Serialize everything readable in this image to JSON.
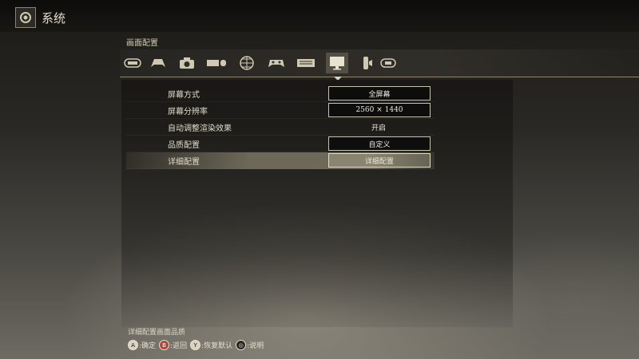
{
  "header": {
    "title": "系统",
    "icon": "gear-icon"
  },
  "section": {
    "title": "画面配置"
  },
  "tabs": [
    {
      "icon": "game-settings-icon"
    },
    {
      "icon": "controller-icon"
    },
    {
      "icon": "camera-icon"
    },
    {
      "icon": "keyboard-mouse-icon"
    },
    {
      "icon": "network-icon"
    },
    {
      "icon": "gamepad-icon"
    },
    {
      "icon": "keyboard-icon"
    },
    {
      "icon": "display-icon",
      "active": true
    },
    {
      "icon": "audio-icon"
    },
    {
      "icon": "pad-icon"
    }
  ],
  "settings": [
    {
      "label": "屏幕方式",
      "value": "全屏幕",
      "style": "boxed"
    },
    {
      "label": "屏幕分辨率",
      "value": "2560 × 1440",
      "style": "boxed"
    },
    {
      "label": "自动调整渲染效果",
      "value": "开启",
      "style": "plain"
    },
    {
      "label": "品质配置",
      "value": "自定义",
      "style": "boxed"
    },
    {
      "label": "详细配置",
      "value": "详细配置",
      "style": "selected"
    }
  ],
  "footer": {
    "description": "详细配置画面品质",
    "hints": [
      {
        "button": "A",
        "label": ":确定"
      },
      {
        "button": "B",
        "label": ":返回"
      },
      {
        "button": "Y",
        "label": ":恢复默认"
      },
      {
        "button": "◎",
        "label": ":说明"
      }
    ]
  },
  "colors": {
    "accent": "#d8d2c0",
    "selected_row": "#aaa287"
  }
}
